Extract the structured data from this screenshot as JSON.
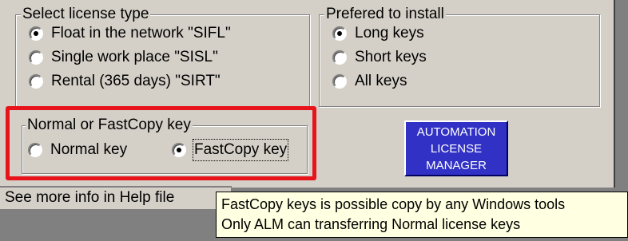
{
  "license_type": {
    "title": "Select license type",
    "options": [
      {
        "label": "Float in the network \"SIFL\"",
        "checked": true
      },
      {
        "label": "Single work place \"SISL\"",
        "checked": false
      },
      {
        "label": "Rental (365 days) \"SIRT\"",
        "checked": false
      }
    ]
  },
  "install_pref": {
    "title": "Prefered to install",
    "options": [
      {
        "label": "Long keys",
        "checked": true
      },
      {
        "label": "Short keys",
        "checked": false
      },
      {
        "label": "All keys",
        "checked": false
      }
    ]
  },
  "key_type": {
    "title": "Normal or FastCopy key",
    "options": [
      {
        "label": "Normal key",
        "checked": false
      },
      {
        "label": "FastCopy key",
        "checked": true
      }
    ]
  },
  "alm_button": {
    "line1": "AUTOMATION",
    "line2": "LICENSE",
    "line3": "MANAGER"
  },
  "status_text": "See more info in Help file",
  "tooltip": {
    "line1": "FastCopy keys is possible copy by any Windows tools",
    "line2": "Only ALM can transferring Normal license keys"
  },
  "colors": {
    "panel": "#d4d0c8",
    "highlight": "#e8141b",
    "button": "#3131c6",
    "tooltip_bg": "#ffffe1"
  }
}
